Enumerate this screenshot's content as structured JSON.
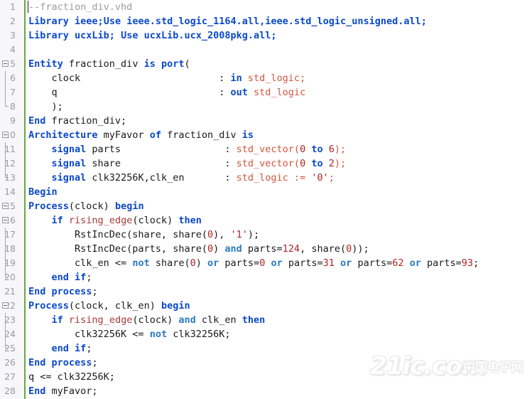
{
  "file": {
    "name": "fraction_div.vhd",
    "language": "VHDL"
  },
  "colors": {
    "keyword": "#0b49c9",
    "type": "#d4553c",
    "function": "#a63939",
    "number": "#b22222",
    "operator": "#2a7ac4",
    "comment": "#9b9b9b",
    "plain": "#1a1a1a",
    "gutter_bg": "#f7f7f9",
    "line_number": "#9a9a9a",
    "change_bar": "#6aa63f",
    "editor_bg": "#ffffff"
  },
  "watermark": {
    "main": "21ic.com",
    "cn": "中国电子网"
  },
  "editor": {
    "total_lines": 28,
    "lines": [
      {
        "no": "1",
        "fold": "none",
        "caret": true,
        "tokens": [
          {
            "t": "--fraction_div.vhd",
            "c": "cmt"
          }
        ]
      },
      {
        "no": "2",
        "fold": "none",
        "tokens": [
          {
            "t": "Library",
            "c": "kw"
          },
          {
            "t": " ieee;",
            "c": "kw"
          },
          {
            "t": "Use",
            "c": "kw"
          },
          {
            "t": " ieee.",
            "c": "kw"
          },
          {
            "t": "std_logic_1164",
            "c": "kw"
          },
          {
            "t": ".all,ieee.",
            "c": "kw"
          },
          {
            "t": "std_logic_unsigned",
            "c": "kw"
          },
          {
            "t": ".all;",
            "c": "kw"
          }
        ]
      },
      {
        "no": "3",
        "fold": "none",
        "tokens": [
          {
            "t": "Library",
            "c": "kw"
          },
          {
            "t": " ucxLib; ",
            "c": "kw"
          },
          {
            "t": "Use",
            "c": "kw"
          },
          {
            "t": " ucxLib.",
            "c": "kw"
          },
          {
            "t": "ucx_2008pkg",
            "c": "kw"
          },
          {
            "t": ".all;",
            "c": "kw"
          }
        ]
      },
      {
        "no": "4",
        "fold": "none",
        "tokens": []
      },
      {
        "no": "5",
        "fold": "box",
        "tokens": [
          {
            "t": "Entity",
            "c": "kw"
          },
          {
            "t": " fraction_div ",
            "c": "pl"
          },
          {
            "t": "is",
            "c": "kw"
          },
          {
            "t": " ",
            "c": "pl"
          },
          {
            "t": "port",
            "c": "kw"
          },
          {
            "t": "(",
            "c": "pl"
          }
        ]
      },
      {
        "no": "6",
        "fold": "line",
        "tokens": [
          {
            "t": "    clock",
            "c": "pl"
          },
          {
            "t": "                        : ",
            "c": "pl"
          },
          {
            "t": "in",
            "c": "kw"
          },
          {
            "t": " ",
            "c": "pl"
          },
          {
            "t": "std_logic",
            "c": "typ"
          },
          {
            "t": ";",
            "c": "typ"
          }
        ]
      },
      {
        "no": "7",
        "fold": "line",
        "tokens": [
          {
            "t": "    q",
            "c": "pl"
          },
          {
            "t": "                            : ",
            "c": "pl"
          },
          {
            "t": "out",
            "c": "kw"
          },
          {
            "t": " ",
            "c": "pl"
          },
          {
            "t": "std_logic",
            "c": "typ"
          }
        ]
      },
      {
        "no": "8",
        "fold": "end",
        "tokens": [
          {
            "t": "    );",
            "c": "pl"
          }
        ]
      },
      {
        "no": "9",
        "fold": "none",
        "tokens": [
          {
            "t": "End",
            "c": "kw"
          },
          {
            "t": " fraction_div;",
            "c": "pl"
          }
        ]
      },
      {
        "no": "10",
        "fold": "box",
        "tokens": [
          {
            "t": "Architecture",
            "c": "kw"
          },
          {
            "t": " myFavor ",
            "c": "pl"
          },
          {
            "t": "of",
            "c": "kw"
          },
          {
            "t": " fraction_div ",
            "c": "pl"
          },
          {
            "t": "is",
            "c": "kw"
          }
        ]
      },
      {
        "no": "11",
        "fold": "line",
        "tokens": [
          {
            "t": "    ",
            "c": "pl"
          },
          {
            "t": "signal",
            "c": "kw"
          },
          {
            "t": " parts",
            "c": "pl"
          },
          {
            "t": "                  : ",
            "c": "pl"
          },
          {
            "t": "std_vector",
            "c": "typ"
          },
          {
            "t": "(",
            "c": "typ"
          },
          {
            "t": "0",
            "c": "num"
          },
          {
            "t": " ",
            "c": "typ"
          },
          {
            "t": "to",
            "c": "kw"
          },
          {
            "t": " ",
            "c": "typ"
          },
          {
            "t": "6",
            "c": "num"
          },
          {
            "t": ");",
            "c": "typ"
          }
        ]
      },
      {
        "no": "12",
        "fold": "line",
        "tokens": [
          {
            "t": "    ",
            "c": "pl"
          },
          {
            "t": "signal",
            "c": "kw"
          },
          {
            "t": " share",
            "c": "pl"
          },
          {
            "t": "                  : ",
            "c": "pl"
          },
          {
            "t": "std_vector",
            "c": "typ"
          },
          {
            "t": "(",
            "c": "typ"
          },
          {
            "t": "0",
            "c": "num"
          },
          {
            "t": " ",
            "c": "typ"
          },
          {
            "t": "to",
            "c": "kw"
          },
          {
            "t": " ",
            "c": "typ"
          },
          {
            "t": "2",
            "c": "num"
          },
          {
            "t": ");",
            "c": "typ"
          }
        ]
      },
      {
        "no": "13",
        "fold": "end",
        "tokens": [
          {
            "t": "    ",
            "c": "pl"
          },
          {
            "t": "signal",
            "c": "kw"
          },
          {
            "t": " clk32256K,clk_en",
            "c": "pl"
          },
          {
            "t": "       : ",
            "c": "pl"
          },
          {
            "t": "std_logic",
            "c": "typ"
          },
          {
            "t": " := ",
            "c": "typ"
          },
          {
            "t": "'0'",
            "c": "str"
          },
          {
            "t": ";",
            "c": "typ"
          }
        ]
      },
      {
        "no": "14",
        "fold": "none",
        "tokens": [
          {
            "t": "Begin",
            "c": "kw"
          }
        ]
      },
      {
        "no": "15",
        "fold": "box",
        "tokens": [
          {
            "t": "Process",
            "c": "kw"
          },
          {
            "t": "(clock) ",
            "c": "pl"
          },
          {
            "t": "begin",
            "c": "kw"
          }
        ]
      },
      {
        "no": "16",
        "fold": "box-inner",
        "tokens": [
          {
            "t": "    ",
            "c": "pl"
          },
          {
            "t": "if",
            "c": "kw"
          },
          {
            "t": " ",
            "c": "pl"
          },
          {
            "t": "rising_edge",
            "c": "fn"
          },
          {
            "t": "(clock) ",
            "c": "pl"
          },
          {
            "t": "then",
            "c": "kw"
          }
        ]
      },
      {
        "no": "17",
        "fold": "line",
        "tokens": [
          {
            "t": "        RstIncDec(share, share(",
            "c": "pl"
          },
          {
            "t": "0",
            "c": "num"
          },
          {
            "t": "), ",
            "c": "pl"
          },
          {
            "t": "'1'",
            "c": "str"
          },
          {
            "t": ");",
            "c": "pl"
          }
        ]
      },
      {
        "no": "18",
        "fold": "line",
        "tokens": [
          {
            "t": "        RstIncDec(parts, share(",
            "c": "pl"
          },
          {
            "t": "0",
            "c": "num"
          },
          {
            "t": ") ",
            "c": "pl"
          },
          {
            "t": "and",
            "c": "op"
          },
          {
            "t": " parts=",
            "c": "pl"
          },
          {
            "t": "124",
            "c": "num"
          },
          {
            "t": ", share(",
            "c": "pl"
          },
          {
            "t": "0",
            "c": "num"
          },
          {
            "t": "));",
            "c": "pl"
          }
        ]
      },
      {
        "no": "19",
        "fold": "tick",
        "tokens": [
          {
            "t": "        clk_en <= ",
            "c": "pl"
          },
          {
            "t": "not",
            "c": "op"
          },
          {
            "t": " share(",
            "c": "pl"
          },
          {
            "t": "0",
            "c": "num"
          },
          {
            "t": ") ",
            "c": "pl"
          },
          {
            "t": "or",
            "c": "op"
          },
          {
            "t": " parts=",
            "c": "pl"
          },
          {
            "t": "0",
            "c": "num"
          },
          {
            "t": " ",
            "c": "pl"
          },
          {
            "t": "or",
            "c": "op"
          },
          {
            "t": " parts=",
            "c": "pl"
          },
          {
            "t": "31",
            "c": "num"
          },
          {
            "t": " ",
            "c": "pl"
          },
          {
            "t": "or",
            "c": "op"
          },
          {
            "t": " parts=",
            "c": "pl"
          },
          {
            "t": "62",
            "c": "num"
          },
          {
            "t": " ",
            "c": "pl"
          },
          {
            "t": "or",
            "c": "op"
          },
          {
            "t": " parts=",
            "c": "pl"
          },
          {
            "t": "93",
            "c": "num"
          },
          {
            "t": ";",
            "c": "pl"
          }
        ]
      },
      {
        "no": "20",
        "fold": "end",
        "tokens": [
          {
            "t": "    ",
            "c": "pl"
          },
          {
            "t": "end",
            "c": "kw"
          },
          {
            "t": " ",
            "c": "pl"
          },
          {
            "t": "if",
            "c": "kw"
          },
          {
            "t": ";",
            "c": "pl"
          }
        ]
      },
      {
        "no": "21",
        "fold": "none",
        "tokens": [
          {
            "t": "End",
            "c": "kw"
          },
          {
            "t": " ",
            "c": "pl"
          },
          {
            "t": "process",
            "c": "kw"
          },
          {
            "t": ";",
            "c": "pl"
          }
        ]
      },
      {
        "no": "22",
        "fold": "box",
        "tokens": [
          {
            "t": "Process",
            "c": "kw"
          },
          {
            "t": "(clock, clk_en) ",
            "c": "pl"
          },
          {
            "t": "begin",
            "c": "kw"
          }
        ]
      },
      {
        "no": "23",
        "fold": "line",
        "tokens": [
          {
            "t": "    ",
            "c": "pl"
          },
          {
            "t": "if",
            "c": "kw"
          },
          {
            "t": " ",
            "c": "pl"
          },
          {
            "t": "rising_edge",
            "c": "fn"
          },
          {
            "t": "(clock) ",
            "c": "pl"
          },
          {
            "t": "and",
            "c": "op"
          },
          {
            "t": " clk_en ",
            "c": "pl"
          },
          {
            "t": "then",
            "c": "kw"
          }
        ]
      },
      {
        "no": "24",
        "fold": "line",
        "tokens": [
          {
            "t": "        clk32256K <= ",
            "c": "pl"
          },
          {
            "t": "not",
            "c": "op"
          },
          {
            "t": " clk32256K;",
            "c": "pl"
          }
        ]
      },
      {
        "no": "25",
        "fold": "end",
        "tokens": [
          {
            "t": "    ",
            "c": "pl"
          },
          {
            "t": "end",
            "c": "kw"
          },
          {
            "t": " ",
            "c": "pl"
          },
          {
            "t": "if",
            "c": "kw"
          },
          {
            "t": ";",
            "c": "pl"
          }
        ]
      },
      {
        "no": "26",
        "fold": "none",
        "tokens": [
          {
            "t": "End",
            "c": "kw"
          },
          {
            "t": " ",
            "c": "pl"
          },
          {
            "t": "process",
            "c": "kw"
          },
          {
            "t": ";",
            "c": "pl"
          }
        ]
      },
      {
        "no": "27",
        "fold": "none",
        "tokens": [
          {
            "t": "q <= clk32256K;",
            "c": "pl"
          }
        ]
      },
      {
        "no": "28",
        "fold": "none",
        "tokens": [
          {
            "t": "End",
            "c": "kw"
          },
          {
            "t": " myFavor;",
            "c": "pl"
          }
        ]
      }
    ]
  }
}
